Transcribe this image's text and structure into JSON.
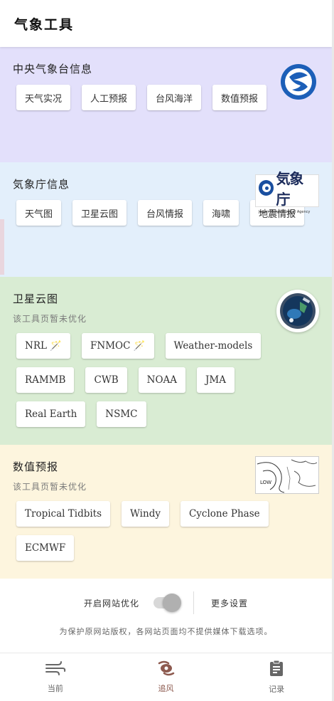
{
  "app": {
    "title": "气象工具"
  },
  "colors": {
    "cma_bg": "#e3e0fb",
    "jma_bg": "#e3effb",
    "sat_bg": "#d9ecd3",
    "nwp_bg": "#fdf5de",
    "nav_active": "#8d5a4f"
  },
  "sections": {
    "cma": {
      "title": "中央气象台信息",
      "chips": [
        "天气实况",
        "人工预报",
        "台风海洋",
        "数值预报"
      ],
      "logo": "cma-logo-icon"
    },
    "jma": {
      "title": "気象庁信息",
      "chips": [
        "天气图",
        "卫星云图",
        "台风情报",
        "海啸",
        "地震情报"
      ],
      "logo_text": "気象庁",
      "logo_sub": "Japan Meteorological Agency"
    },
    "satellite": {
      "title": "卫星云图",
      "subtitle": "该工具页暂未优化",
      "chips": [
        "NRL 🪄",
        "FNMOC 🪄",
        "Weather-models",
        "RAMMB",
        "CWB",
        "NOAA",
        "JMA",
        "Real Earth",
        "NSMC"
      ],
      "logo": "satellite-globe-icon"
    },
    "nwp": {
      "title": "数值预报",
      "subtitle": "该工具页暂未优化",
      "chips": [
        "Tropical Tidbits",
        "Windy",
        "Cyclone Phase",
        "ECMWF"
      ],
      "logo": "weather-map-icon",
      "map_label": "LOW"
    }
  },
  "settings": {
    "toggle_label": "开启网站优化",
    "toggle_on": false,
    "more_label": "更多设置",
    "notice": "为保护原网站版权，各网站页面均不提供媒体下载选项。"
  },
  "nav": [
    {
      "label": "当前",
      "icon": "wind-icon"
    },
    {
      "label": "追风",
      "icon": "hurricane-icon",
      "active": true
    },
    {
      "label": "记录",
      "icon": "clipboard-icon"
    }
  ]
}
